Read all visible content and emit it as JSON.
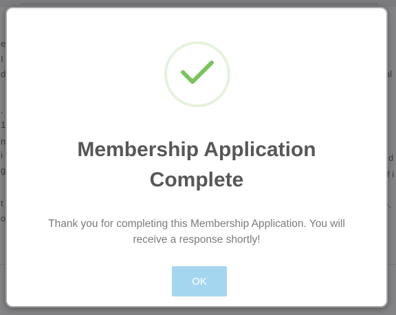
{
  "background_page": {
    "left_fragments": [
      "e",
      "I",
      "d",
      ",",
      "1",
      "n",
      "i",
      "g",
      "t",
      "o"
    ],
    "right_fragments": [
      "al",
      "d",
      "f i",
      ")."
    ]
  },
  "modal": {
    "icon": "checkmark-icon",
    "title_line1": "Membership Application",
    "title_line2": "Complete",
    "message_line1": "Thank you for completing this Membership Application. You will",
    "message_line2": "receive a response shortly!",
    "ok_label": "OK",
    "colors": {
      "check": "#7cc35e",
      "ring": "#e6f2dd",
      "button": "#a5d6f0",
      "title": "#575757",
      "message": "#7b7b7b"
    }
  }
}
